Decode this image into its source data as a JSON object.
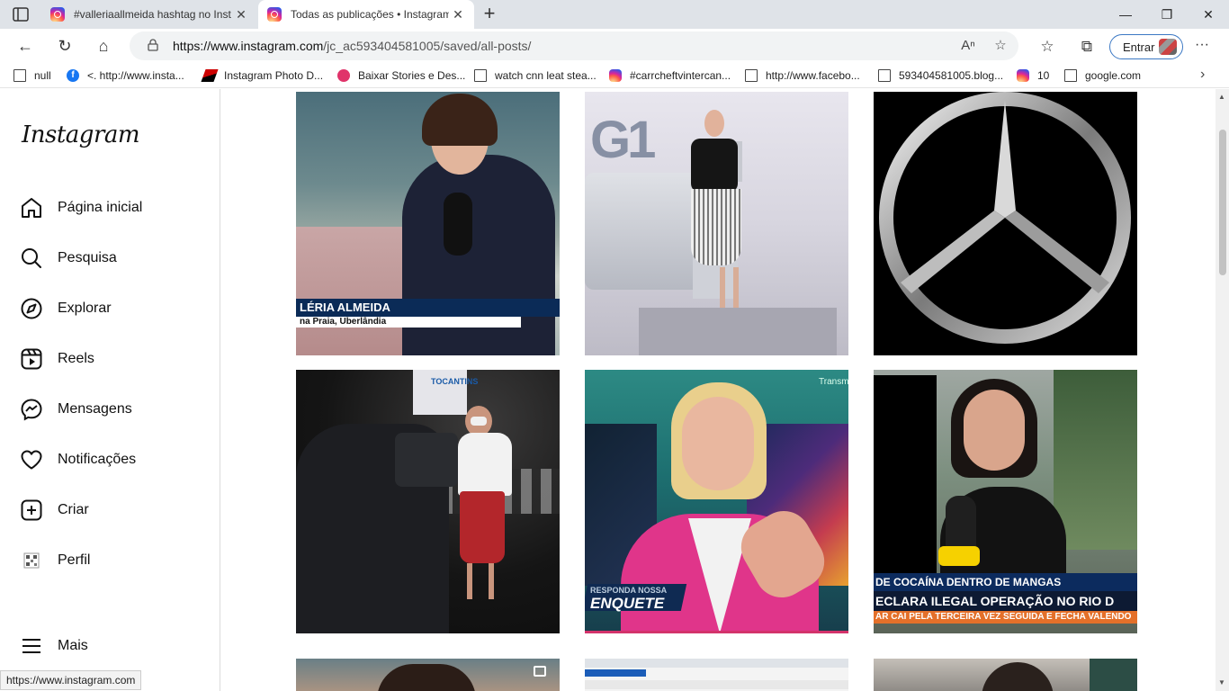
{
  "browser": {
    "tabs": [
      {
        "title": "#valleriaallmeida hashtag no Inst",
        "active": false
      },
      {
        "title": "Todas as publicações • Instagram",
        "active": true
      }
    ],
    "url_base": "https://www.instagram.com",
    "url_path": "/jc_ac593404581005/saved/all-posts/",
    "signin_label": "Entrar",
    "status_url": "https://www.instagram.com"
  },
  "bookmarks": [
    {
      "label": "null",
      "icon": "page-icon"
    },
    {
      "label": "<. http://www.insta...",
      "icon": "facebook-icon"
    },
    {
      "label": "Instagram Photo D...",
      "icon": "red-brand-icon"
    },
    {
      "label": "Baixar Stories e Des...",
      "icon": "pink-brand-icon"
    },
    {
      "label": "watch cnn leat stea...",
      "icon": "page-icon"
    },
    {
      "label": "#carrcheftvintercan...",
      "icon": "instagram-icon"
    },
    {
      "label": "http://www.facebo...",
      "icon": "page-icon"
    },
    {
      "label": "593404581005.blog...",
      "icon": "page-icon"
    },
    {
      "label": "10",
      "icon": "instagram-icon"
    },
    {
      "label": "google.com",
      "icon": "page-icon"
    }
  ],
  "sidebar": {
    "logo": "Instagram",
    "items": [
      {
        "label": "Página inicial",
        "icon": "home-icon"
      },
      {
        "label": "Pesquisa",
        "icon": "search-icon"
      },
      {
        "label": "Explorar",
        "icon": "compass-icon"
      },
      {
        "label": "Reels",
        "icon": "reels-icon"
      },
      {
        "label": "Mensagens",
        "icon": "messenger-icon"
      },
      {
        "label": "Notificações",
        "icon": "heart-icon"
      },
      {
        "label": "Criar",
        "icon": "plus-square-icon"
      },
      {
        "label": "Perfil",
        "icon": "profile-avatar-icon"
      }
    ],
    "more_label": "Mais"
  },
  "posts": [
    {
      "caption1": "LÉRIA ALMEIDA",
      "caption2": "na Praia, Uberlândia"
    },
    {
      "caption1": "G1"
    },
    {
      "caption1": "mercedes-logo"
    },
    {
      "caption1": "TOCANTINS"
    },
    {
      "caption1": "Transm",
      "caption2": "RESPONDA NOSSA",
      "caption3": "ENQUETE"
    },
    {
      "caption1": "DE COCAÍNA DENTRO DE MANGAS",
      "caption2": "ECLARA ILEGAL OPERAÇÃO NO RIO D",
      "caption3": "AR CAI PELA TERCEIRA VEZ SEGUIDA E FECHA VALENDO"
    }
  ]
}
